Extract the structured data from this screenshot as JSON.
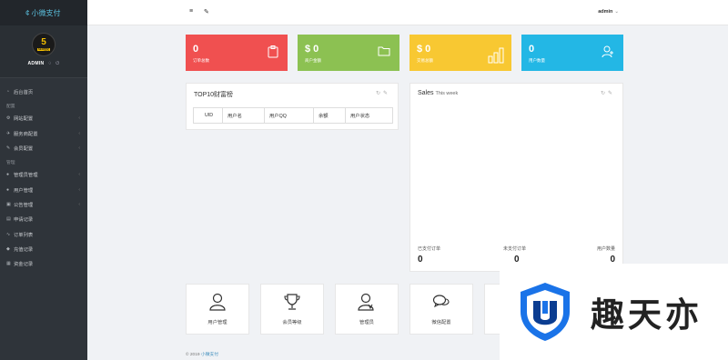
{
  "brand": {
    "name": "小微支付",
    "symbol": "¢"
  },
  "profile": {
    "avatar_num": "5",
    "avatar_tag": "SEO优化",
    "username": "ADMIN"
  },
  "sidebar": {
    "items": [
      {
        "label": "后台首页",
        "icon": "◔"
      },
      {
        "section": "配置"
      },
      {
        "label": "网站配置",
        "icon": "⚙",
        "chev": "‹"
      },
      {
        "label": "服务商配置",
        "icon": "✈",
        "chev": "‹"
      },
      {
        "label": "会员配置",
        "icon": "✎",
        "chev": "‹"
      },
      {
        "section": "管理"
      },
      {
        "label": "管理员管理",
        "icon": "●",
        "chev": "‹"
      },
      {
        "label": "用户管理",
        "icon": "●",
        "chev": "‹"
      },
      {
        "label": "公告管理",
        "icon": "▣",
        "chev": "‹"
      },
      {
        "label": "申请记录",
        "icon": "▤"
      },
      {
        "label": "订单列表",
        "icon": "∿"
      },
      {
        "label": "充值记录",
        "icon": "◆"
      },
      {
        "label": "资金记录",
        "icon": "▦"
      }
    ]
  },
  "topbar": {
    "menu_icon": "≡",
    "tool_icon": "✎",
    "user": "admin",
    "caret": "⌄"
  },
  "stats": [
    {
      "value": "0",
      "label": "订单总数",
      "color": "#f05050"
    },
    {
      "value": "$ 0",
      "label": "商户金额",
      "color": "#8cc152"
    },
    {
      "value": "$ 0",
      "label": "交易总额",
      "color": "#f8c832"
    },
    {
      "value": "0",
      "label": "用户数量",
      "color": "#23b7e5"
    }
  ],
  "top10": {
    "title": "TOP10财富榜",
    "columns": [
      "UID",
      "用户名",
      "用户QQ",
      "余额",
      "用户状态"
    ]
  },
  "sales": {
    "title": "Sales",
    "subtitle": "This week",
    "stats": [
      {
        "label": "已支付订单",
        "value": "0"
      },
      {
        "label": "未支付订单",
        "value": "0"
      },
      {
        "label": "用户数量",
        "value": "0"
      }
    ]
  },
  "tiles": [
    {
      "label": "用户管理"
    },
    {
      "label": "会员等级"
    },
    {
      "label": "管理员"
    },
    {
      "label": "微信配置"
    }
  ],
  "footer": {
    "text": "© 2019",
    "link": "小微支付"
  },
  "watermark": {
    "text": "趣天亦",
    "colors": {
      "blue": "#1a73e8",
      "dark": "#0b3d91"
    }
  }
}
